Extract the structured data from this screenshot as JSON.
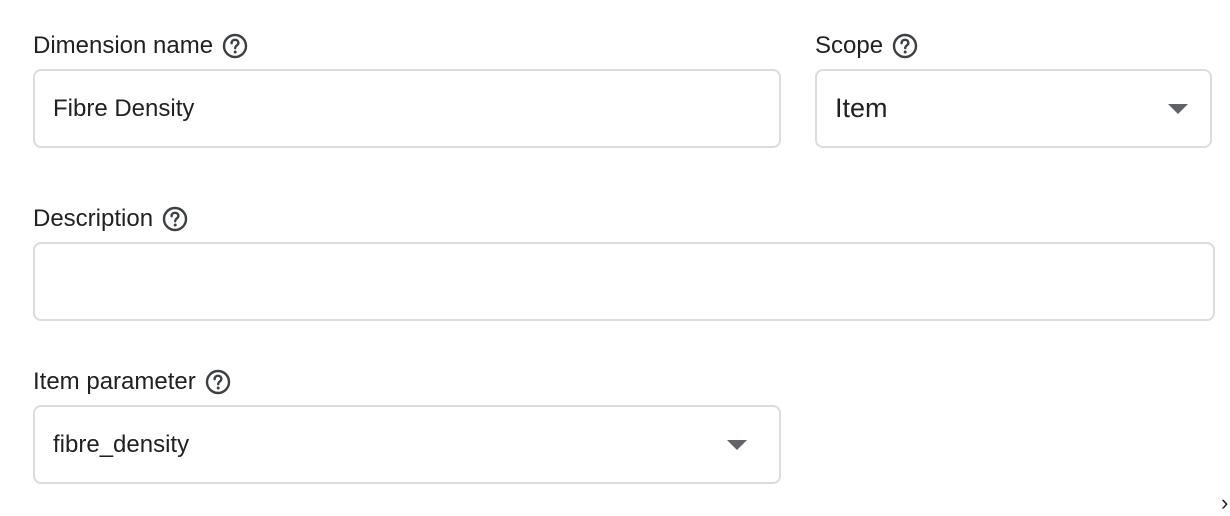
{
  "dimension_name": {
    "label": "Dimension name",
    "value": "Fibre Density",
    "help_icon": "help-circle-icon"
  },
  "scope": {
    "label": "Scope",
    "selected": "Item",
    "help_icon": "help-circle-icon",
    "caret_icon": "dropdown-caret-icon"
  },
  "description": {
    "label": "Description",
    "value": "",
    "help_icon": "help-circle-icon"
  },
  "item_parameter": {
    "label": "Item parameter",
    "selected": "fibre_density",
    "help_icon": "help-circle-icon",
    "caret_icon": "dropdown-caret-icon"
  },
  "edge_glyph": "›",
  "colors": {
    "text": "#202124",
    "border": "#dadce0",
    "icon": "#3c4043",
    "caret": "#5f6368"
  }
}
